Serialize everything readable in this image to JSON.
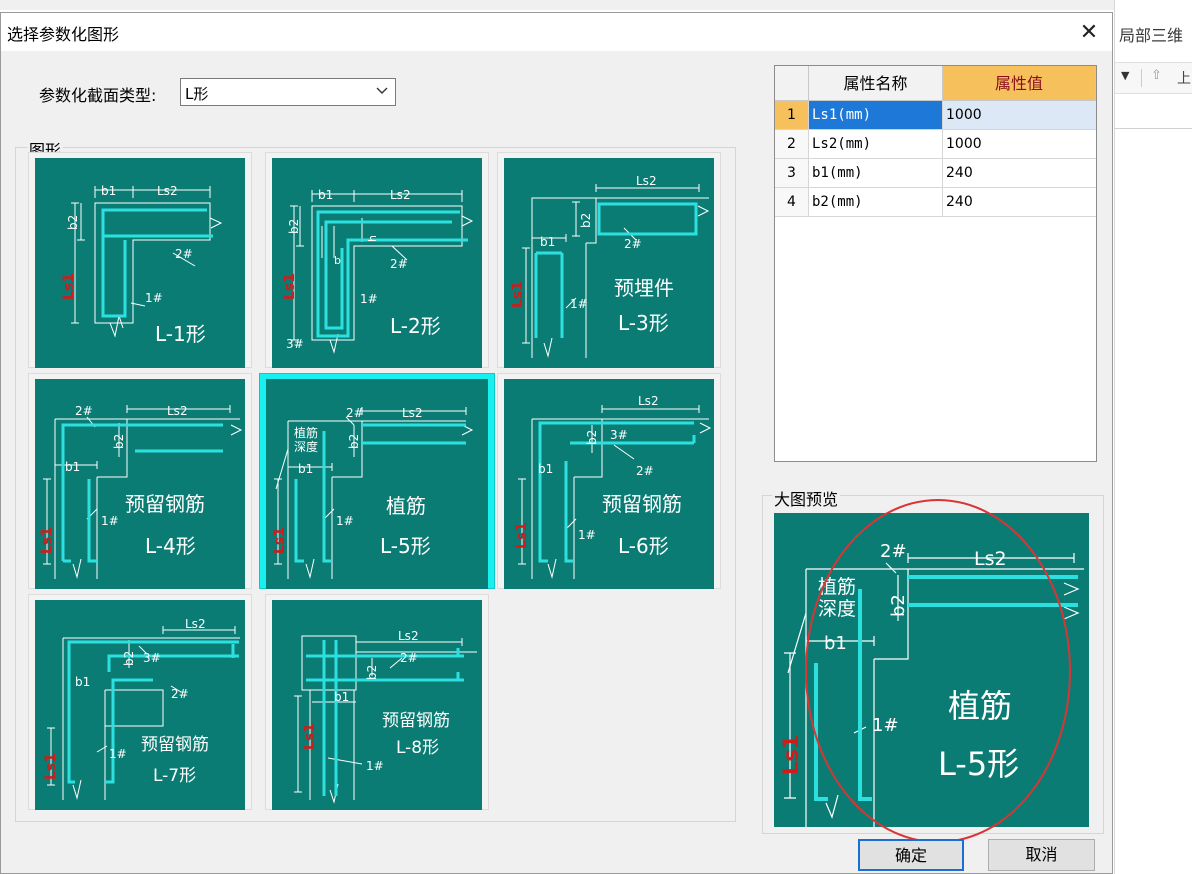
{
  "background_app": {
    "right_panel_title": "局部三维",
    "toolbar_partial_text": "上"
  },
  "dialog": {
    "title": "选择参数化图形",
    "close_symbol": "✕",
    "section_type_label": "参数化截面类型:",
    "section_type_value": "L形",
    "shapes_group_label": "图形",
    "preview_group_label": "大图预览",
    "ok_button": "确定",
    "cancel_button": "取消"
  },
  "colors": {
    "diagram_bg": "#0a7c74",
    "rebar": "#2de0e0",
    "line": "#ffffff",
    "dim_red": "#d11a1a",
    "selection": "#18f0f0",
    "header_value": "#f6c05c"
  },
  "shapes": [
    {
      "id": "L-1",
      "title": "L-1形",
      "caption": "",
      "labels": {
        "b1": "b1",
        "ls2": "Ls2",
        "b2": "b2",
        "ls1": "Ls1",
        "bar1": "1#",
        "bar2": "2#"
      }
    },
    {
      "id": "L-2",
      "title": "L-2形",
      "caption": "",
      "labels": {
        "b1": "b1",
        "ls2": "Ls2",
        "b2": "b2",
        "ls1": "Ls1",
        "bar1": "1#",
        "bar2": "2#",
        "bar3": "3#",
        "h": "h",
        "b": "b"
      }
    },
    {
      "id": "L-3",
      "title": "L-3形",
      "caption": "预埋件",
      "labels": {
        "b1": "b1",
        "ls2": "Ls2",
        "b2": "b2",
        "ls1": "Ls1",
        "bar1": "1#",
        "bar2": "2#"
      }
    },
    {
      "id": "L-4",
      "title": "L-4形",
      "caption": "预留钢筋",
      "labels": {
        "b1": "b1",
        "ls2": "Ls2",
        "b2": "b2",
        "ls1": "Ls1",
        "bar1": "1#",
        "bar2": "2#"
      }
    },
    {
      "id": "L-5",
      "title": "L-5形",
      "caption": "植筋",
      "labels": {
        "b1": "b1",
        "ls2": "Ls2",
        "b2": "b2",
        "ls1": "Ls1",
        "bar1": "1#",
        "bar2": "2#",
        "depth1": "植筋",
        "depth2": "深度"
      }
    },
    {
      "id": "L-6",
      "title": "L-6形",
      "caption": "预留钢筋",
      "labels": {
        "b1": "b1",
        "ls2": "Ls2",
        "b2": "b2",
        "ls1": "Ls1",
        "bar1": "1#",
        "bar2": "2#",
        "bar3": "3#"
      }
    },
    {
      "id": "L-7",
      "title": "L-7形",
      "caption": "预留钢筋",
      "labels": {
        "b1": "b1",
        "ls2": "Ls2",
        "b2": "b2",
        "ls1": "Ls1",
        "bar1": "1#",
        "bar2": "2#",
        "bar3": "3#"
      }
    },
    {
      "id": "L-8",
      "title": "L-8形",
      "caption": "预留钢筋",
      "labels": {
        "b1": "b1",
        "ls2": "Ls2",
        "b2": "b2",
        "ls1": "Ls1",
        "bar1": "1#",
        "bar2": "2#"
      }
    }
  ],
  "selected_shape": "L-5",
  "properties": {
    "headers": [
      "属性名称",
      "属性值"
    ],
    "rows": [
      {
        "index": "1",
        "name": "Ls1(mm)",
        "value": "1000"
      },
      {
        "index": "2",
        "name": "Ls2(mm)",
        "value": "1000"
      },
      {
        "index": "3",
        "name": "b1(mm)",
        "value": "240"
      },
      {
        "index": "4",
        "name": "b2(mm)",
        "value": "240"
      }
    ]
  },
  "preview": {
    "title": "L-5形",
    "caption": "植筋",
    "labels": {
      "b1": "b1",
      "ls2": "Ls2",
      "b2": "b2",
      "ls1": "Ls1",
      "bar1": "1#",
      "bar2": "2#",
      "depth1": "植筋",
      "depth2": "深度"
    }
  }
}
